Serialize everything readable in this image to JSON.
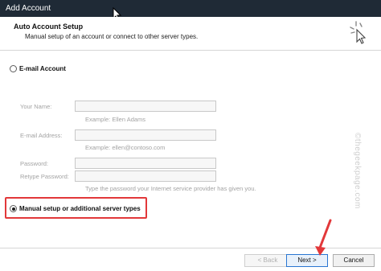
{
  "window": {
    "title": "Add Account"
  },
  "header": {
    "title": "Auto Account Setup",
    "subtitle": "Manual setup of an account or connect to other server types."
  },
  "options": {
    "email_account": {
      "label": "E-mail Account",
      "checked": false
    },
    "manual_setup": {
      "label": "Manual setup or additional server types",
      "checked": true
    }
  },
  "form": {
    "your_name": {
      "label": "Your Name:",
      "value": "",
      "hint": "Example: Ellen Adams"
    },
    "email_address": {
      "label": "E-mail Address:",
      "value": "",
      "hint": "Example: ellen@contoso.com"
    },
    "password": {
      "label": "Password:",
      "value": ""
    },
    "retype_password": {
      "label": "Retype Password:",
      "value": "",
      "hint": "Type the password your Internet service provider has given you."
    }
  },
  "watermark": "©thegeekpage.com",
  "footer": {
    "back_label": "< Back",
    "next_label": "Next >",
    "cancel_label": "Cancel"
  },
  "colors": {
    "titlebar": "#1f2a36",
    "highlight": "#e2383a",
    "primary_border": "#2a76d2"
  }
}
